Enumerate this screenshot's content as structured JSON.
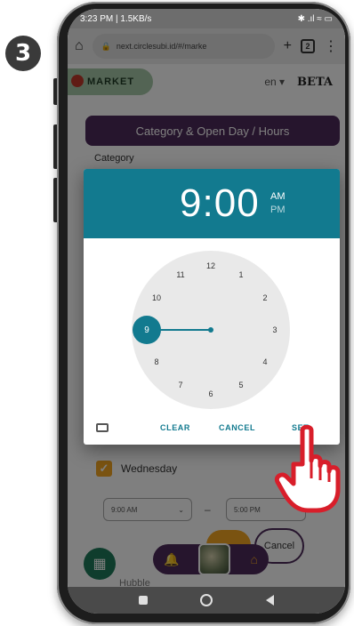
{
  "step_number": "3",
  "status_bar": {
    "time_info": "3:23 PM | 1.5KB/s",
    "right_icons": "✱ .ıl ≈ ▭"
  },
  "browser": {
    "url": "next.circlesubi.id/#/marke",
    "tab_count": "2",
    "home_icon": "home-icon",
    "lock_icon": "lock-icon"
  },
  "app": {
    "logo_text": "MARKET",
    "language": "en",
    "beta_label": "BETA"
  },
  "form": {
    "section_title": "Category & Open Day / Hours",
    "category_label": "Category",
    "day_label": "Wednesday",
    "open_time": "9:00 AM",
    "close_time": "5:00 PM",
    "cancel_label": "Cancel",
    "bottom_text": "Hubble"
  },
  "time_picker": {
    "hour": "9",
    "separator": ":",
    "minutes": "00",
    "am_label": "AM",
    "pm_label": "PM",
    "selected_period": "AM",
    "selected_hour": "9",
    "dial_numbers": [
      "12",
      "1",
      "2",
      "3",
      "4",
      "5",
      "6",
      "7",
      "8",
      "9",
      "10",
      "11"
    ],
    "actions": {
      "clear": "CLEAR",
      "cancel": "CANCEL",
      "set": "SET"
    },
    "accent_color": "#127a8f"
  },
  "colors": {
    "brand_purple": "#4d2a5a",
    "accent_orange": "#f5a623",
    "logo_green": "#a7c9a9"
  }
}
